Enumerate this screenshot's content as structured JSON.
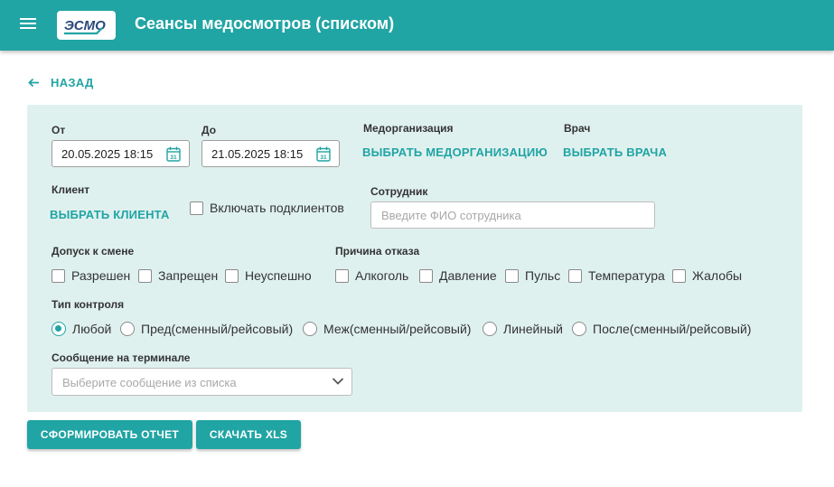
{
  "header": {
    "title": "Сеансы медосмотров (списком)",
    "logo_text": "ЭСМО",
    "menu_icon": "hamburger-menu-icon"
  },
  "back": {
    "label": "НАЗАД",
    "icon": "arrow-left-icon"
  },
  "filters": {
    "from": {
      "label": "От",
      "value": "20.05.2025 18:15"
    },
    "to": {
      "label": "До",
      "value": "21.05.2025 18:15"
    },
    "med_org": {
      "label": "Медорганизация",
      "action": "ВЫБРАТЬ МЕДОРГАНИЗАЦИЮ"
    },
    "doctor": {
      "label": "Врач",
      "action": "ВЫБРАТЬ ВРАЧА"
    },
    "client": {
      "label": "Клиент",
      "action": "ВЫБРАТЬ КЛИЕНТА",
      "include_subclients": "Включать подклиентов"
    },
    "employee": {
      "label": "Сотрудник",
      "placeholder": "Введите ФИО сотрудника",
      "value": ""
    },
    "admission": {
      "label": "Допуск к смене",
      "options": [
        "Разрешен",
        "Запрещен",
        "Неуспешно"
      ]
    },
    "refusal": {
      "label": "Причина отказа",
      "options": [
        "Алкоголь",
        "Давление",
        "Пульс",
        "Температура",
        "Жалобы"
      ]
    },
    "control_type": {
      "label": "Тип контроля",
      "options": [
        "Любой",
        "Пред(сменный/рейсовый)",
        "Меж(сменный/рейсовый)",
        "Линейный",
        "После(сменный/рейсовый)"
      ],
      "selected": "Любой"
    },
    "terminal_message": {
      "label": "Сообщение на терминале",
      "placeholder": "Выберите сообщение из списка"
    }
  },
  "actions": {
    "report": "СФОРМИРОВАТЬ ОТЧЕТ",
    "xls": "СКАЧАТЬ XLS"
  },
  "colors": {
    "accent": "#21a4a4",
    "panel_bg": "#dff1ef"
  }
}
